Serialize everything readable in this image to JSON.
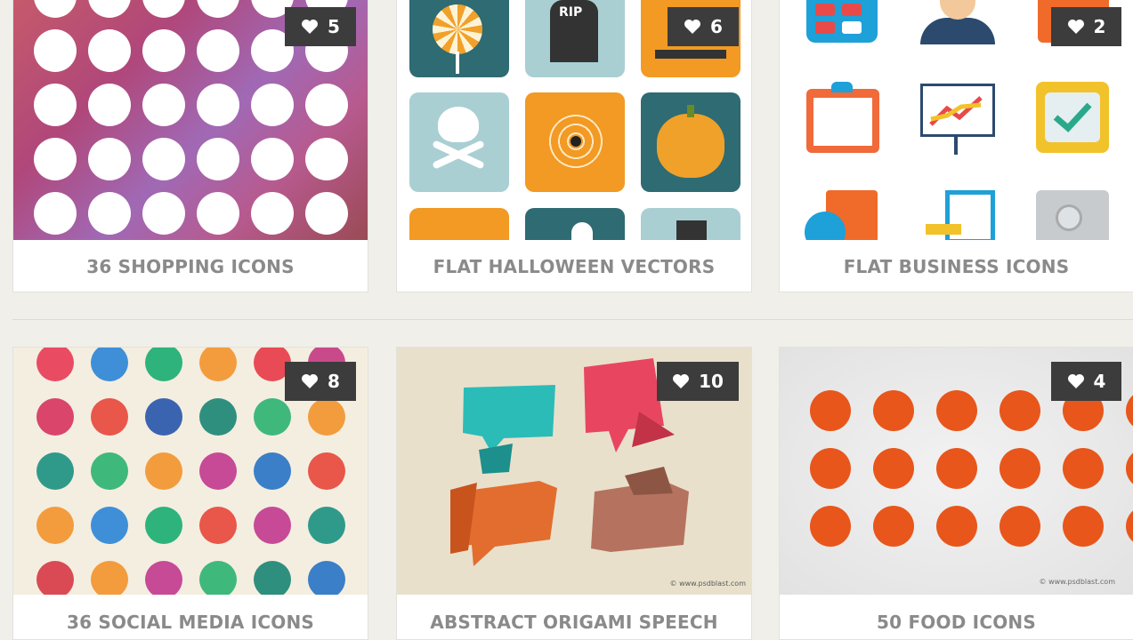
{
  "cards": [
    {
      "title": "36 SHOPPING ICONS",
      "likes": "5"
    },
    {
      "title": "FLAT HALLOWEEN VECTORS",
      "likes": "6"
    },
    {
      "title": "FLAT BUSINESS ICONS",
      "likes": "2"
    },
    {
      "title": "36 SOCIAL MEDIA ICONS",
      "likes": "8"
    },
    {
      "title": "ABSTRACT ORIGAMI SPEECH",
      "likes": "10"
    },
    {
      "title": "50 FOOD ICONS",
      "likes": "4"
    }
  ],
  "thumb_text": {
    "rip": "RIP",
    "origami_credit": "© www.psdblast.com",
    "food_credit": "© www.psdblast.com"
  },
  "colors": {
    "like_badge": "#3c3c3c",
    "caption_text": "#8a8a8a",
    "food_orange": "#e8561b",
    "page_bg": "#f1efea"
  }
}
